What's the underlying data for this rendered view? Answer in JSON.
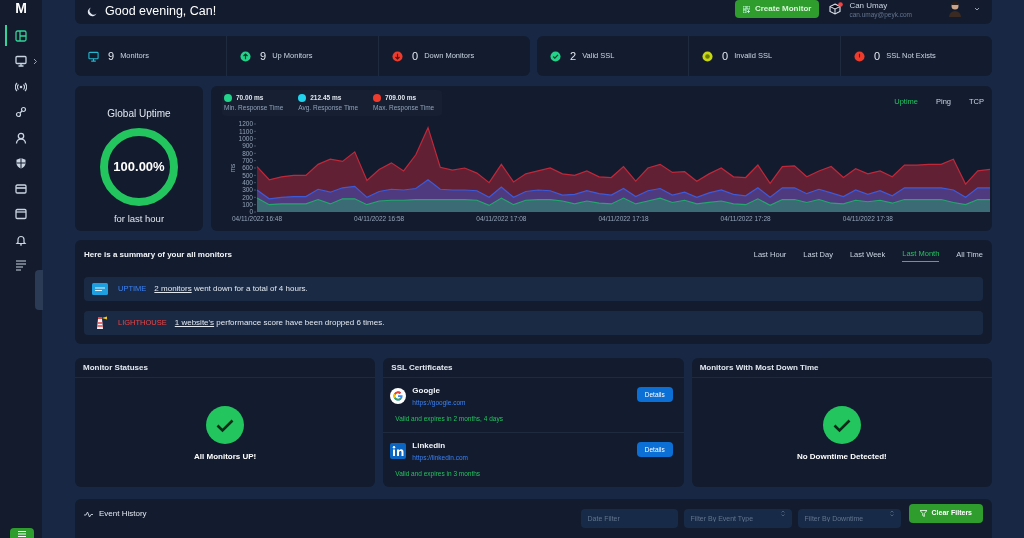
{
  "sidebar": {
    "logo": "M",
    "items": [
      {
        "kind": "layout",
        "selected": true,
        "expandable": false
      },
      {
        "kind": "monitor",
        "selected": false,
        "expandable": true
      },
      {
        "kind": "broadcast",
        "selected": false,
        "expandable": false
      },
      {
        "kind": "link",
        "selected": false,
        "expandable": false
      },
      {
        "kind": "user",
        "selected": false,
        "expandable": false
      },
      {
        "kind": "shield",
        "selected": false,
        "expandable": false
      },
      {
        "kind": "card",
        "selected": false,
        "expandable": false
      },
      {
        "kind": "window",
        "selected": false,
        "expandable": false
      },
      {
        "kind": "bell",
        "selected": false,
        "expandable": false
      },
      {
        "kind": "list",
        "selected": false,
        "expandable": false
      }
    ]
  },
  "header": {
    "greeting": "Good evening, Can!",
    "create_button": "Create Monitor",
    "user": {
      "name": "Can Umay",
      "email": "can.umay@peyk.com"
    }
  },
  "monitor_stats": [
    {
      "kind": "monitor",
      "count": "9",
      "label": "Monitors"
    },
    {
      "kind": "up",
      "count": "9",
      "label": "Up Monitors"
    },
    {
      "kind": "down",
      "count": "0",
      "label": "Down Monitors"
    }
  ],
  "ssl_stats": [
    {
      "kind": "valid",
      "count": "2",
      "label": "Valid SSL"
    },
    {
      "kind": "invalid",
      "count": "0",
      "label": "Invalid SSL"
    },
    {
      "kind": "missing",
      "count": "0",
      "label": "SSL Not Exists"
    }
  ],
  "global_uptime": {
    "title": "Global Uptime",
    "value": "100.00%",
    "level": 1,
    "caption": "for last hour"
  },
  "response_times": {
    "legend": [
      {
        "value": "70.00 ms",
        "color": "#22d38a"
      },
      {
        "value": "212.45 ms",
        "color": "#22d3ee"
      },
      {
        "value": "709.00 ms",
        "color": "#ef3b2c"
      }
    ],
    "tabs": [
      {
        "label": "Uptime",
        "selected": true
      },
      {
        "label": "Ping",
        "selected": false
      },
      {
        "label": "TCP",
        "selected": false
      }
    ],
    "chart_data": {
      "type": "area",
      "ylabel": "ms",
      "categories": [
        "04/11/2022 16:48",
        null,
        null,
        null,
        null,
        null,
        null,
        null,
        null,
        null,
        "04/11/2022 16:58",
        null,
        null,
        null,
        null,
        null,
        null,
        null,
        null,
        null,
        "04/11/2022 17:08",
        null,
        null,
        null,
        null,
        null,
        null,
        null,
        null,
        null,
        "04/11/2022 17:18",
        null,
        null,
        null,
        null,
        null,
        null,
        null,
        null,
        null,
        "04/11/2022 17:28",
        null,
        null,
        null,
        null,
        null,
        null,
        null,
        null,
        null,
        "04/11/2022 17:38",
        null,
        null,
        null,
        null,
        null,
        null,
        null,
        null,
        null,
        null
      ],
      "ylim": [
        0,
        1200
      ],
      "yticks": [
        0,
        100,
        200,
        300,
        400,
        500,
        600,
        700,
        800,
        900,
        1000,
        1100,
        1200
      ],
      "stacked": false,
      "series": [
        {
          "name": "Min. Response Time",
          "color": "#22a86a",
          "values": [
            190,
            100,
            110,
            110,
            110,
            170,
            110,
            180,
            180,
            100,
            150,
            160,
            160,
            170,
            170,
            170,
            170,
            170,
            160,
            90,
            190,
            100,
            160,
            170,
            170,
            150,
            110,
            150,
            120,
            110,
            190,
            110,
            150,
            190,
            130,
            160,
            110,
            130,
            150,
            110,
            100,
            180,
            90,
            170,
            170,
            130,
            170,
            120,
            110,
            160,
            140,
            160,
            120,
            170,
            170,
            170,
            170,
            130,
            100,
            170,
            170
          ]
        },
        {
          "name": "Avg. Response Time",
          "color": "#3b5bdb",
          "values": [
            300,
            180,
            200,
            210,
            210,
            310,
            270,
            330,
            350,
            200,
            280,
            310,
            300,
            320,
            440,
            310,
            300,
            300,
            290,
            200,
            340,
            200,
            280,
            300,
            290,
            230,
            240,
            290,
            250,
            230,
            320,
            210,
            290,
            320,
            230,
            270,
            200,
            260,
            300,
            240,
            220,
            330,
            200,
            330,
            330,
            250,
            310,
            260,
            210,
            300,
            240,
            290,
            220,
            330,
            330,
            330,
            330,
            300,
            200,
            330,
            330
          ]
        },
        {
          "name": "Max. Response Time",
          "color": "#c0283a",
          "values": [
            620,
            440,
            480,
            500,
            500,
            650,
            720,
            690,
            820,
            430,
            580,
            670,
            560,
            780,
            1150,
            610,
            570,
            600,
            530,
            400,
            650,
            410,
            520,
            560,
            600,
            520,
            500,
            560,
            480,
            470,
            620,
            420,
            600,
            650,
            540,
            550,
            420,
            520,
            600,
            480,
            470,
            640,
            390,
            620,
            630,
            480,
            560,
            620,
            470,
            590,
            520,
            560,
            480,
            640,
            640,
            650,
            650,
            720,
            380,
            560,
            580
          ]
        }
      ]
    }
  },
  "summary": {
    "title": "Here is a summary of your all monitors",
    "periods": [
      {
        "label": "Last Hour",
        "selected": false
      },
      {
        "label": "Last Day",
        "selected": false
      },
      {
        "label": "Last Week",
        "selected": false
      },
      {
        "label": "Last Month",
        "selected": true
      },
      {
        "label": "All Time",
        "selected": false
      }
    ],
    "items": [
      {
        "kind": "uptime",
        "tag": "UPTIME",
        "link": "2 monitors",
        "text": " went down for a total of 4 hours."
      },
      {
        "kind": "lighthouse",
        "tag": "LIGHTHOUSE",
        "link": "1 website's",
        "text": " performance score have been dropped 6 times."
      }
    ]
  },
  "monitor_statuses": {
    "title": "Monitor Statuses",
    "message": "All Monitors UP!"
  },
  "ssl_certificates": {
    "title": "SSL Certificates",
    "items": [
      {
        "kind": "google",
        "name": "Google",
        "url": "https://google.com",
        "status": "Valid and expires in 2 months, 4 days",
        "button": "Details"
      },
      {
        "kind": "linkedin",
        "name": "Linkedin",
        "url": "https://linkedin.com",
        "status": "Valid and expires in 3 months",
        "button": "Details"
      }
    ]
  },
  "most_down_time": {
    "title": "Monitors With Most Down Time",
    "message": "No Downtime Detected!"
  },
  "event_history": {
    "title": "Event History",
    "filters": [
      {
        "kind": "text",
        "placeholder": "Date Filter"
      },
      {
        "kind": "select",
        "placeholder": "Filter By Event Type"
      },
      {
        "kind": "select",
        "placeholder": "Filter By Downtime"
      }
    ],
    "button": "Clear Filters"
  }
}
